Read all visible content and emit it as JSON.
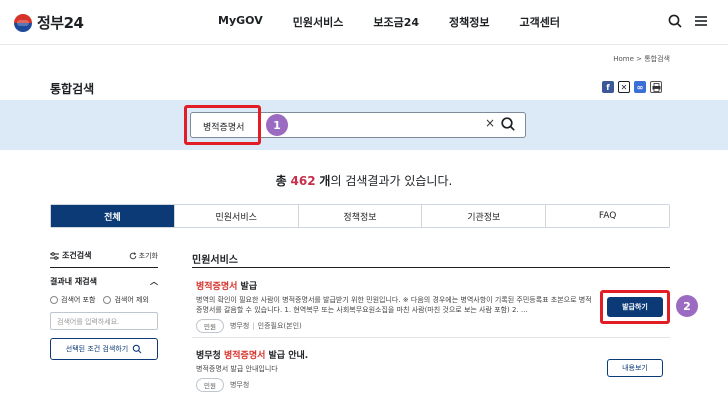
{
  "header": {
    "logo_text": "정부24",
    "nav": [
      "MyGOV",
      "민원서비스",
      "보조금24",
      "정책정보",
      "고객센터"
    ]
  },
  "breadcrumb": {
    "home": "Home",
    "separator": ">",
    "current": "통합검색"
  },
  "page_title": "통합검색",
  "share_icons": [
    "facebook-icon",
    "x-icon",
    "link-icon",
    "print-icon"
  ],
  "search": {
    "value": "병적증명서",
    "clear": "×"
  },
  "steps": {
    "one": "1",
    "two": "2"
  },
  "summary": {
    "prefix": "총",
    "count": "462",
    "unit": "개",
    "suffix": "의 검색결과가 있습니다."
  },
  "tabs": [
    "전체",
    "민원서비스",
    "정책정보",
    "기관정보",
    "FAQ"
  ],
  "filter": {
    "title": "조건검색",
    "reset": "초기화",
    "subtitle": "결과내 재검색",
    "radio_include": "검색어 포함",
    "radio_exclude": "검색어 제외",
    "placeholder": "검색어를 입력하세요.",
    "apply": "선택된 조건 검색하기"
  },
  "results": {
    "section_title": "민원서비스",
    "items": [
      {
        "title_hl": "병적증명서",
        "title_rest": " 발급",
        "desc": "병역의 확인이 필요한 사람이 병적증명서를 발급받기 위한 민원입니다. ※ 다음의 경우에는 병역사항이 기록된 주민등록표 초본으로 병적증명서를 갈음할 수 있습니다. 1. 현역복무 또는 사회복무요원소집을 마친 사람(마친 것으로 보는 사람 포함) 2. …",
        "tag": "민원",
        "org": "병무청",
        "extra": "인증필요(본인)",
        "button": "발급하기"
      },
      {
        "title_pre": "병무청 ",
        "title_hl": "병적증명서",
        "title_rest": " 발급 안내.",
        "desc": "병적증명서 발급 안내입니다",
        "tag": "민원",
        "org": "병무청",
        "button": "내용보기"
      }
    ]
  },
  "colors": {
    "navy": "#0b3a76",
    "highlight": "#d6332a",
    "count": "#c6304a",
    "band": "#dce9f7",
    "annotation_red": "#e31d25",
    "annotation_step": "#9b6bc2"
  }
}
